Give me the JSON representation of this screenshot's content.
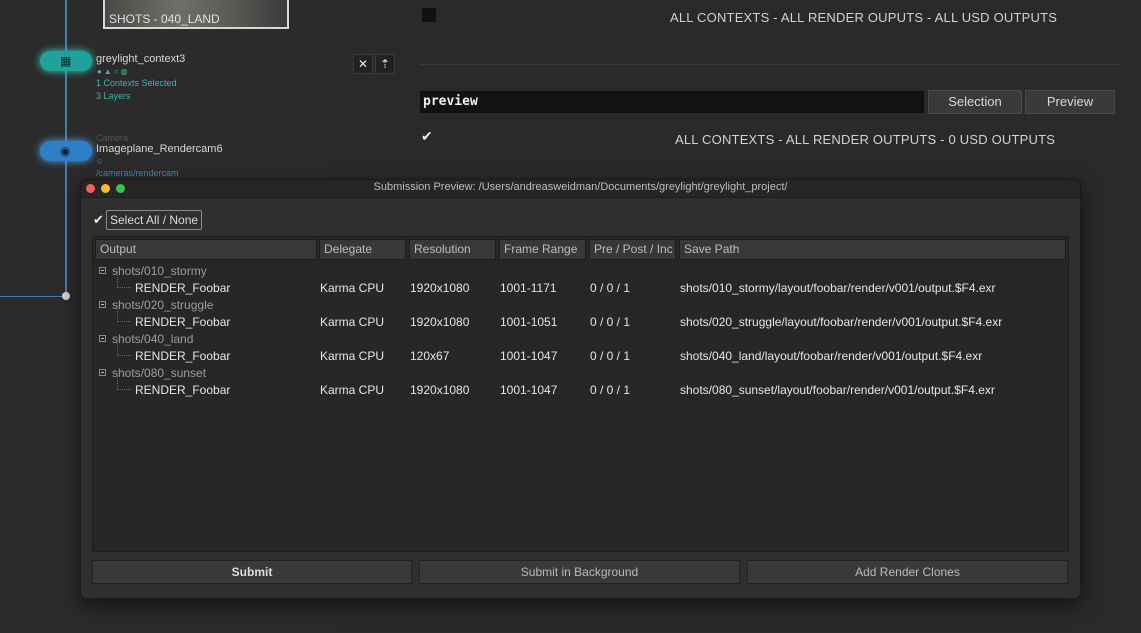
{
  "graph": {
    "thumbnail_label": "SHOTS - 040_LAND",
    "context_node": {
      "name": "greylight_context3",
      "sub_1": "1 Contexts Selected",
      "sub_2": "3 Layers"
    },
    "camera_node": {
      "type_label": "Camera",
      "name": "Imageplane_Rendercam6",
      "path": "/cameras/rendercam"
    }
  },
  "params": {
    "line_1": "ALL CONTEXTS  -  ALL RENDER OUPUTS  -  ALL USD OUTPUTS",
    "close_glyph": "✕",
    "arrow_glyph": "⇡",
    "search_value": "preview",
    "selection_button": "Selection",
    "preview_button": "Preview",
    "check_glyph": "✔",
    "line_2": "ALL CONTEXTS  -  ALL RENDER OUTPUTS  -  0 USD OUTPUTS"
  },
  "window": {
    "title": "Submission Preview: /Users/andreasweidman/Documents/greylight/greylight_project/",
    "traffic_colors": [
      "#fc5f57",
      "#fdbc2e",
      "#33c748"
    ],
    "select_all_check": "✔",
    "select_all_label": "Select All / None",
    "columns": [
      "Output",
      "Delegate",
      "Resolution",
      "Frame Range",
      "Pre / Post / Inc",
      "Save Path"
    ],
    "groups": [
      {
        "name": "shots/010_stormy",
        "output": "RENDER_Foobar",
        "delegate": "Karma CPU",
        "resolution": "1920x1080",
        "frame_range": "1001-1171",
        "pre_post_inc": "0 / 0 / 1",
        "save_path": "shots/010_stormy/layout/foobar/render/v001/output.$F4.exr"
      },
      {
        "name": "shots/020_struggle",
        "output": "RENDER_Foobar",
        "delegate": "Karma CPU",
        "resolution": "1920x1080",
        "frame_range": "1001-1051",
        "pre_post_inc": "0 / 0 / 1",
        "save_path": "shots/020_struggle/layout/foobar/render/v001/output.$F4.exr"
      },
      {
        "name": "shots/040_land",
        "output": "RENDER_Foobar",
        "delegate": "Karma CPU",
        "resolution": "120x67",
        "frame_range": "1001-1047",
        "pre_post_inc": "0 / 0 / 1",
        "save_path": "shots/040_land/layout/foobar/render/v001/output.$F4.exr"
      },
      {
        "name": "shots/080_sunset",
        "output": "RENDER_Foobar",
        "delegate": "Karma CPU",
        "resolution": "1920x1080",
        "frame_range": "1001-1047",
        "pre_post_inc": "0 / 0 / 1",
        "save_path": "shots/080_sunset/layout/foobar/render/v001/output.$F4.exr"
      }
    ],
    "buttons": {
      "submit": "Submit",
      "submit_background": "Submit in Background",
      "add_clones": "Add Render Clones"
    }
  }
}
